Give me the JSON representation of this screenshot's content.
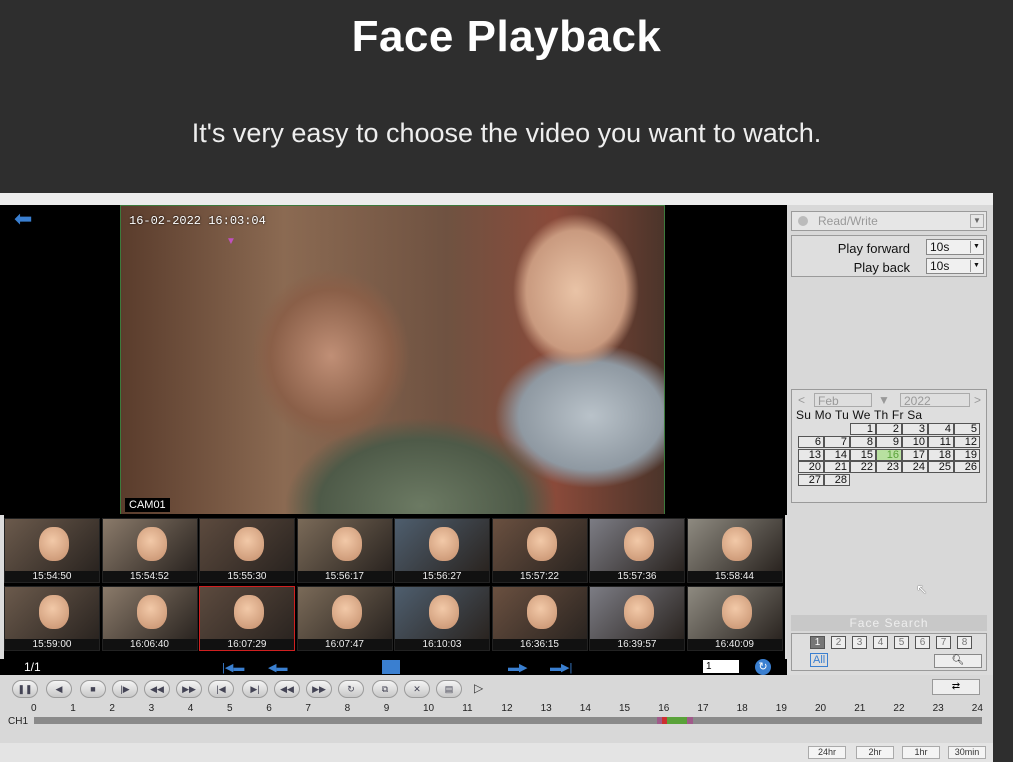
{
  "promo": {
    "title": "Face Playback",
    "subtitle": "It's very easy to choose the video you want to watch."
  },
  "video": {
    "timestamp": "16-02-2022 16:03:04",
    "camera": "CAM01"
  },
  "sidebar": {
    "mode": "Read/Write",
    "play_forward_label": "Play forward",
    "play_forward_value": "10s",
    "play_back_label": "Play back",
    "play_back_value": "10s"
  },
  "calendar": {
    "month": "Feb",
    "year": "2022",
    "weekdays": "Su Mo Tu We Th  Fr  Sa",
    "weeks": [
      [
        "",
        "",
        "1",
        "2",
        "3",
        "4",
        "5"
      ],
      [
        "6",
        "7",
        "8",
        "9",
        "10",
        "11",
        "12"
      ],
      [
        "13",
        "14",
        "15",
        "16",
        "17",
        "18",
        "19"
      ],
      [
        "20",
        "21",
        "22",
        "23",
        "24",
        "25",
        "26"
      ],
      [
        "27",
        "28",
        "",
        "",
        "",
        "",
        ""
      ]
    ],
    "recorded_day": "16"
  },
  "face_search": {
    "label": "Face Search",
    "pages": [
      "1",
      "2",
      "3",
      "4",
      "5",
      "6",
      "7",
      "8"
    ],
    "active_page": "1",
    "all_label": "All"
  },
  "thumbnails": [
    {
      "time": "15:54:50"
    },
    {
      "time": "15:54:52"
    },
    {
      "time": "15:55:30"
    },
    {
      "time": "15:56:17"
    },
    {
      "time": "15:56:27"
    },
    {
      "time": "15:57:22"
    },
    {
      "time": "15:57:36"
    },
    {
      "time": "15:58:44"
    },
    {
      "time": "15:59:00"
    },
    {
      "time": "16:06:40"
    },
    {
      "time": "16:07:29"
    },
    {
      "time": "16:07:47"
    },
    {
      "time": "16:10:03"
    },
    {
      "time": "16:36:15"
    },
    {
      "time": "16:39:57"
    },
    {
      "time": "16:40:09"
    }
  ],
  "selected_thumbnail": 10,
  "status": {
    "page_count": "1/1",
    "page_input": "1"
  },
  "timeline": {
    "channel": "CH1",
    "hours": [
      "0",
      "1",
      "2",
      "3",
      "4",
      "5",
      "6",
      "7",
      "8",
      "9",
      "10",
      "11",
      "12",
      "13",
      "14",
      "15",
      "16",
      "17",
      "18",
      "19",
      "20",
      "21",
      "22",
      "23",
      "24"
    ]
  },
  "zoom": [
    "24hr",
    "2hr",
    "1hr",
    "30min"
  ],
  "colors": {
    "accent": "#3a7fd0",
    "record_green": "#5aa23a",
    "selection_red": "#d02020"
  }
}
